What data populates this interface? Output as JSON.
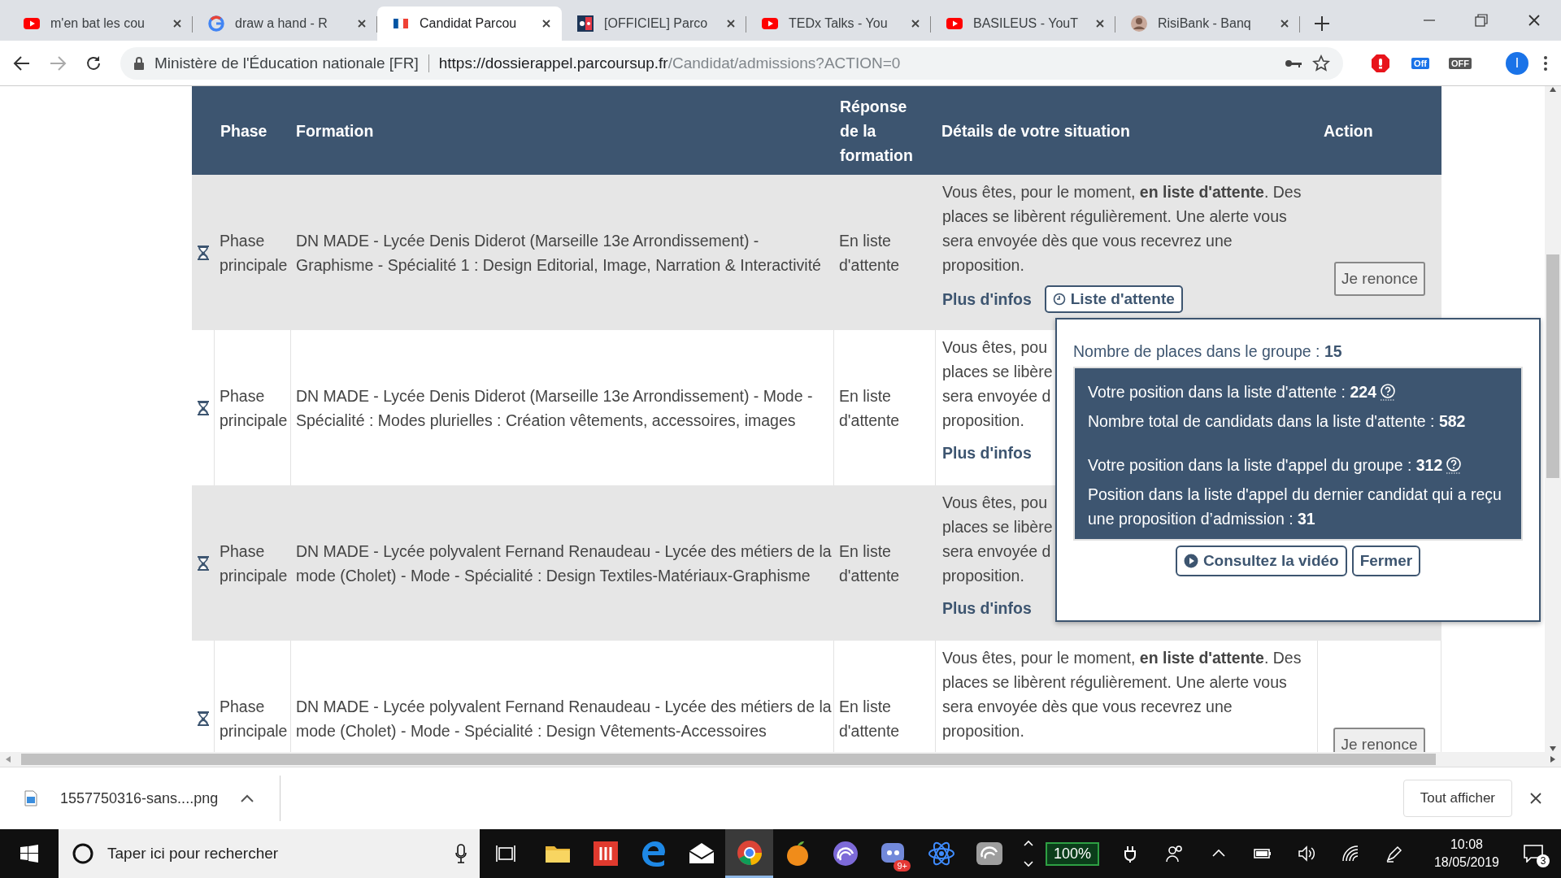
{
  "browser": {
    "tabs": [
      {
        "kind": "youtube",
        "title": "m'en bat les cou",
        "selected": false
      },
      {
        "kind": "google",
        "title": "draw a hand - R",
        "selected": false
      },
      {
        "kind": "flag",
        "title": "Candidat Parcou",
        "selected": true
      },
      {
        "kind": "officiel",
        "title": "[OFFICIEL] Parco",
        "selected": false
      },
      {
        "kind": "youtube",
        "title": "TEDx Talks - You",
        "selected": false
      },
      {
        "kind": "youtube",
        "title": "BASILEUS - YouT",
        "selected": false
      },
      {
        "kind": "avatar",
        "title": "RisiBank - Banq",
        "selected": false
      }
    ],
    "site_identity": "Ministère de l'Éducation nationale [FR]",
    "url": {
      "host": "https://dossierappel.parcoursup.fr",
      "path": "/Candidat/admissions?ACTION=0"
    },
    "extension_badges": [
      "Off",
      "OFF"
    ],
    "profile_initial": "I"
  },
  "table": {
    "columns": [
      "Phase",
      "Formation",
      "Réponse de la formation",
      "Détails de votre situation",
      "Action"
    ],
    "rows": [
      {
        "phase": "Phase principale",
        "formation": "DN MADE - Lycée Denis Diderot (Marseille 13e Arrondissement) - Graphisme - Spécialité 1 : Design Editorial, Image, Narration & Interactivité",
        "response": "En liste d'attente",
        "details": "Vous êtes, pour le moment, **en liste d'attente**. Des places se libèrent régulièrement. Une alerte vous sera envoyée dès que vous recevrez une proposition.",
        "more_info": "Plus d'infos",
        "waitlist_button": "Liste d'attente",
        "action": "Je renonce"
      },
      {
        "phase": "Phase principale",
        "formation": "DN MADE - Lycée Denis Diderot (Marseille 13e Arrondissement) - Mode - Spécialité : Modes plurielles : Création vêtements, accessoires, images",
        "response": "En liste d'attente",
        "details_visible": [
          "Vous êtes, pou",
          "places se libère",
          "sera envoyée d",
          "proposition."
        ],
        "more_info": "Plus d'infos"
      },
      {
        "phase": "Phase principale",
        "formation": "DN MADE - Lycée polyvalent Fernand Renaudeau - Lycée des métiers de la mode (Cholet) - Mode - Spécialité : Design Textiles-Matériaux-Graphisme",
        "response": "En liste d'attente",
        "details_visible": [
          "Vous êtes, pou",
          "places se libère",
          "sera envoyée d",
          "proposition."
        ],
        "more_info": "Plus d'infos"
      },
      {
        "phase": "Phase principale",
        "formation": "DN MADE - Lycée polyvalent Fernand Renaudeau - Lycée des métiers de la mode (Cholet) - Mode - Spécialité : Design Vêtements-Accessoires",
        "response": "En liste d'attente",
        "details": "Vous êtes, pour le moment, **en liste d'attente**. Des places se libèrent régulièrement. Une alerte vous sera envoyée dès que vous recevrez une proposition.",
        "action": "Je renonce"
      }
    ]
  },
  "popup": {
    "places": "Nombre de places dans le groupe : **15**",
    "stat_groups": [
      [
        {
          "text": "Votre position dans la liste d'attente : **224**",
          "help": true
        },
        {
          "text": "Nombre total de candidats dans la liste d'attente : **582**",
          "help": false
        }
      ],
      [
        {
          "text": "Votre position dans la liste d'appel du groupe : **312**",
          "help": true
        },
        {
          "text": "Position dans la liste d'appel du dernier candidat qui a reçu une proposition d’admission : **31**",
          "help": false
        }
      ]
    ],
    "video_button": "Consultez la vidéo",
    "close_button": "Fermer"
  },
  "download_bar": {
    "file_name": "1557750316-sans....png",
    "show_all_button": "Tout afficher"
  },
  "taskbar": {
    "search_placeholder": "Taper ici pour rechercher",
    "apps": [
      {
        "kind": "folder",
        "selected": false
      },
      {
        "kind": "red",
        "selected": false
      },
      {
        "kind": "edge",
        "selected": false
      },
      {
        "kind": "mail",
        "selected": false
      },
      {
        "kind": "chrome",
        "selected": true
      },
      {
        "kind": "fruit",
        "selected": false
      },
      {
        "kind": "swirl",
        "selected": false
      },
      {
        "kind": "chat",
        "selected": false,
        "badge": "9+"
      },
      {
        "kind": "atom",
        "selected": false
      },
      {
        "kind": "grey",
        "selected": false
      }
    ],
    "battery": "100%",
    "time": "10:08",
    "date": "18/05/2019",
    "notification_count": "3"
  }
}
